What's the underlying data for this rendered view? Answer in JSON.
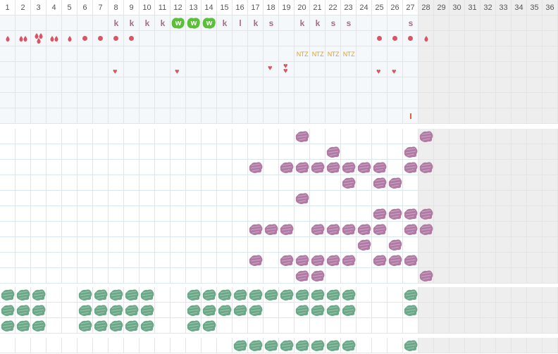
{
  "days": [
    "1",
    "2",
    "3",
    "4",
    "5",
    "6",
    "7",
    "8",
    "9",
    "10",
    "11",
    "12",
    "13",
    "14",
    "15",
    "16",
    "17",
    "18",
    "19",
    "20",
    "21",
    "22",
    "23",
    "24",
    "25",
    "26",
    "27",
    "28",
    "29",
    "30",
    "31",
    "32",
    "33",
    "34",
    "35",
    "36"
  ],
  "active_days": 27,
  "colors": {
    "letter": "#a96a88",
    "wedge": "#5cbf3a",
    "drop": "#d95565",
    "heart": "#d95565",
    "ntz": "#e0a020",
    "mark": "#e06040",
    "purple": "#b07aa5",
    "green": "#6aa888"
  },
  "icons": {
    "drop": "blood-drop-icon",
    "dot": "dot-icon",
    "heart": "heart-icon",
    "wedge": "w-badge-icon",
    "blob": "scribble-mark-icon",
    "tick": "tick-mark-icon"
  },
  "row_letters": [
    {
      "day": 8,
      "text": "k"
    },
    {
      "day": 9,
      "text": "k"
    },
    {
      "day": 10,
      "text": "k"
    },
    {
      "day": 11,
      "text": "k"
    },
    {
      "day": 15,
      "text": "k"
    },
    {
      "day": 16,
      "text": "l"
    },
    {
      "day": 17,
      "text": "k"
    },
    {
      "day": 18,
      "text": "s"
    },
    {
      "day": 20,
      "text": "k"
    },
    {
      "day": 21,
      "text": "k"
    },
    {
      "day": 22,
      "text": "s"
    },
    {
      "day": 23,
      "text": "s"
    },
    {
      "day": 27,
      "text": "s"
    }
  ],
  "row_wedges": [
    {
      "day": 12,
      "text": "w"
    },
    {
      "day": 13,
      "text": "w"
    },
    {
      "day": 14,
      "text": "w"
    }
  ],
  "row_bleeding": [
    {
      "day": 1,
      "kind": "drop1"
    },
    {
      "day": 2,
      "kind": "drop2"
    },
    {
      "day": 3,
      "kind": "drop3"
    },
    {
      "day": 4,
      "kind": "drop2"
    },
    {
      "day": 5,
      "kind": "drop1"
    },
    {
      "day": 6,
      "kind": "dot"
    },
    {
      "day": 7,
      "kind": "dot"
    },
    {
      "day": 8,
      "kind": "dot"
    },
    {
      "day": 9,
      "kind": "dot"
    },
    {
      "day": 25,
      "kind": "dot"
    },
    {
      "day": 26,
      "kind": "dot"
    },
    {
      "day": 27,
      "kind": "dot"
    },
    {
      "day": 28,
      "kind": "drop1"
    }
  ],
  "row_ntz": [
    {
      "day": 20,
      "text": "NTZ"
    },
    {
      "day": 21,
      "text": "NTZ"
    },
    {
      "day": 22,
      "text": "NTZ"
    },
    {
      "day": 23,
      "text": "NTZ"
    }
  ],
  "row_hearts": [
    {
      "day": 8,
      "count": 1
    },
    {
      "day": 12,
      "count": 1
    },
    {
      "day": 18,
      "count": 1
    },
    {
      "day": 19,
      "count": 2
    },
    {
      "day": 25,
      "count": 1
    },
    {
      "day": 26,
      "count": 1
    }
  ],
  "row_tick": [
    27
  ],
  "purple_rows": [
    [
      20,
      28
    ],
    [
      22,
      27
    ],
    [
      17,
      19,
      20,
      21,
      22,
      23,
      24,
      25,
      27,
      28
    ],
    [
      23,
      25,
      26
    ],
    [
      20
    ],
    [
      25,
      26,
      27,
      28
    ],
    [
      17,
      18,
      19,
      21,
      22,
      23,
      24,
      25,
      27,
      28
    ],
    [
      24,
      26
    ],
    [
      17,
      19,
      20,
      21,
      22,
      23,
      25,
      26,
      27
    ],
    [
      20,
      21,
      28
    ]
  ],
  "green_rows": [
    [
      1,
      2,
      3,
      6,
      7,
      8,
      9,
      10,
      13,
      14,
      15,
      16,
      17,
      18,
      19,
      20,
      21,
      22,
      23,
      27
    ],
    [
      1,
      2,
      3,
      6,
      7,
      8,
      9,
      10,
      13,
      14,
      15,
      16,
      17,
      20,
      21,
      22,
      23,
      27
    ],
    [
      1,
      2,
      3,
      6,
      7,
      8,
      9,
      10,
      13,
      14
    ]
  ],
  "bottom_row": [
    16,
    17,
    18,
    19,
    20,
    21,
    22,
    23,
    27
  ]
}
